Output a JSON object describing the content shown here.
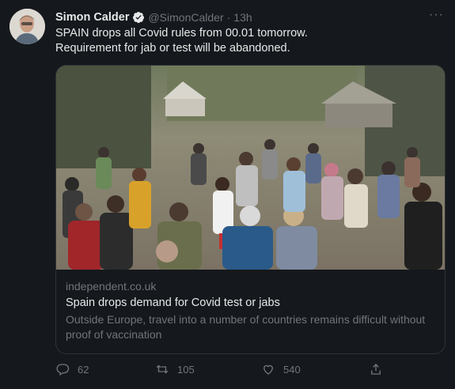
{
  "author": {
    "name": "Simon Calder",
    "handle": "@SimonCalder",
    "separator": "·",
    "time": "13h"
  },
  "icons": {
    "verified": "verified-badge-icon",
    "more": "more-icon",
    "reply": "reply-icon",
    "retweet": "retweet-icon",
    "like": "like-icon",
    "share": "share-icon"
  },
  "more_label": "···",
  "tweet": {
    "line1": "SPAIN drops all Covid rules from 00.01 tomorrow.",
    "line2": "Requirement for jab or test will be abandoned."
  },
  "card": {
    "domain": "independent.co.uk",
    "title": "Spain drops demand for Covid test or jabs",
    "description": "Outside Europe, travel into a number of countries remains difficult without proof of vaccination"
  },
  "actions": {
    "replies": "62",
    "retweets": "105",
    "likes": "540"
  },
  "colors": {
    "background": "#15181c",
    "text": "#e7e9ea",
    "muted": "#71767b",
    "border": "#2f3336",
    "verified": "#e7e9ea"
  }
}
